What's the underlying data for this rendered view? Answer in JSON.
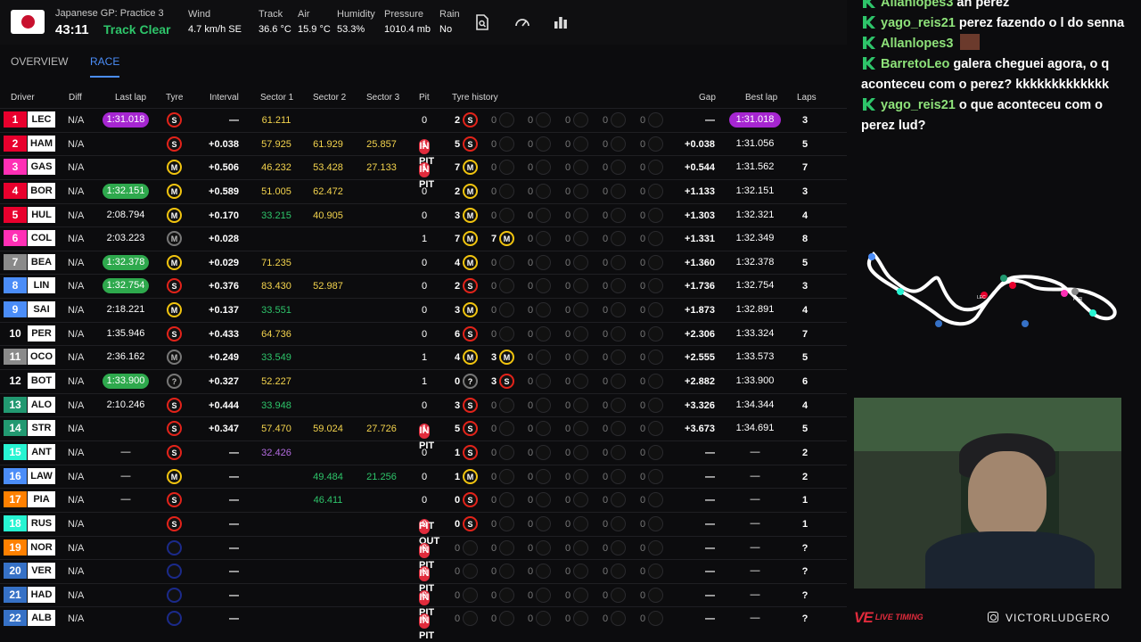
{
  "session": {
    "title": "Japanese GP: Practice 3",
    "clock": "43:11",
    "track_status": "Track Clear",
    "flag_icon": "japan-flag-icon"
  },
  "weather": [
    {
      "label": "Wind",
      "value": "4.7 km/h SE"
    },
    {
      "label": "Track",
      "value": "36.6 °C"
    },
    {
      "label": "Air",
      "value": "15.9 °C"
    },
    {
      "label": "Humidity",
      "value": "53.3%"
    },
    {
      "label": "Pressure",
      "value": "1010.4 mb"
    },
    {
      "label": "Rain",
      "value": "No"
    }
  ],
  "toolbar_icons": [
    "search-doc-icon",
    "speedometer-icon",
    "bar-chart-icon"
  ],
  "tabs": [
    {
      "label": "OVERVIEW",
      "active": false
    },
    {
      "label": "RACE",
      "active": true
    }
  ],
  "columns": {
    "driver": "Driver",
    "diff": "Diff",
    "last_lap": "Last lap",
    "tyre": "Tyre",
    "interval": "Interval",
    "s1": "Sector 1",
    "s2": "Sector 2",
    "s3": "Sector 3",
    "pit": "Pit",
    "tyre_history": "Tyre history",
    "gap": "Gap",
    "best_lap": "Best lap",
    "laps": "Laps"
  },
  "colors": {
    "personal_best": "#2ea94d",
    "overall_best": "#a626d1",
    "in_pit": "#e12b3c",
    "soft": "#e2231a",
    "medium": "#f1c40f",
    "sector_yellow": "#f4d44d",
    "sector_green": "#2ec56a",
    "sector_purple": "#b36be0",
    "accent": "#4b8df8"
  },
  "drivers": [
    {
      "pos": "1",
      "code": "LEC",
      "color": "#e8002d",
      "diff": "N/A",
      "last": "1:31.018",
      "last_style": "ob",
      "tyre": "S",
      "interval": "—",
      "s1": "61.211",
      "s1c": "y",
      "s2": "",
      "s2c": "",
      "s3": "",
      "s3c": "",
      "pit": "0",
      "hist": [
        [
          "2",
          "S"
        ],
        [
          "0",
          ""
        ],
        [
          "0",
          ""
        ],
        [
          "0",
          ""
        ],
        [
          "0",
          ""
        ],
        [
          "0",
          ""
        ]
      ],
      "gap": "—",
      "best": "1:31.018",
      "best_style": "ob",
      "laps": "3"
    },
    {
      "pos": "2",
      "code": "HAM",
      "color": "#e8002d",
      "diff": "N/A",
      "last": "IN PIT",
      "last_style": "pit",
      "tyre": "S",
      "interval": "+0.038",
      "s1": "57.925",
      "s1c": "y",
      "s2": "61.929",
      "s2c": "y",
      "s3": "25.857",
      "s3c": "y",
      "pit": "1",
      "hist": [
        [
          "5",
          "S"
        ],
        [
          "0",
          ""
        ],
        [
          "0",
          ""
        ],
        [
          "0",
          ""
        ],
        [
          "0",
          ""
        ],
        [
          "0",
          ""
        ]
      ],
      "gap": "+0.038",
      "best": "1:31.056",
      "best_style": "",
      "laps": "5"
    },
    {
      "pos": "3",
      "code": "GAS",
      "color": "#ff2fb5",
      "diff": "N/A",
      "last": "IN PIT",
      "last_style": "pit",
      "tyre": "M",
      "interval": "+0.506",
      "s1": "46.232",
      "s1c": "y",
      "s2": "53.428",
      "s2c": "y",
      "s3": "27.133",
      "s3c": "y",
      "pit": "1",
      "hist": [
        [
          "7",
          "M"
        ],
        [
          "0",
          ""
        ],
        [
          "0",
          ""
        ],
        [
          "0",
          ""
        ],
        [
          "0",
          ""
        ],
        [
          "0",
          ""
        ]
      ],
      "gap": "+0.544",
      "best": "1:31.562",
      "best_style": "",
      "laps": "7"
    },
    {
      "pos": "4",
      "code": "BOR",
      "color": "#e8002d",
      "diff": "N/A",
      "last": "1:32.151",
      "last_style": "pb",
      "tyre": "M",
      "interval": "+0.589",
      "s1": "51.005",
      "s1c": "y",
      "s2": "62.472",
      "s2c": "y",
      "s3": "",
      "s3c": "",
      "pit": "0",
      "hist": [
        [
          "2",
          "M"
        ],
        [
          "0",
          ""
        ],
        [
          "0",
          ""
        ],
        [
          "0",
          ""
        ],
        [
          "0",
          ""
        ],
        [
          "0",
          ""
        ]
      ],
      "gap": "+1.133",
      "best": "1:32.151",
      "best_style": "",
      "laps": "3"
    },
    {
      "pos": "5",
      "code": "HUL",
      "color": "#e8002d",
      "diff": "N/A",
      "last": "2:08.794",
      "last_style": "plain",
      "tyre": "M",
      "interval": "+0.170",
      "s1": "33.215",
      "s1c": "g",
      "s2": "40.905",
      "s2c": "y",
      "s3": "",
      "s3c": "",
      "pit": "0",
      "hist": [
        [
          "3",
          "M"
        ],
        [
          "0",
          ""
        ],
        [
          "0",
          ""
        ],
        [
          "0",
          ""
        ],
        [
          "0",
          ""
        ],
        [
          "0",
          ""
        ]
      ],
      "gap": "+1.303",
      "best": "1:32.321",
      "best_style": "",
      "laps": "4"
    },
    {
      "pos": "6",
      "code": "COL",
      "color": "#ff2fb5",
      "diff": "N/A",
      "last": "2:03.223",
      "last_style": "plain",
      "tyre": "U",
      "interval": "+0.028",
      "s1": "",
      "s1c": "",
      "s2": "",
      "s2c": "",
      "s3": "",
      "s3c": "",
      "pit": "1",
      "hist": [
        [
          "7",
          "M"
        ],
        [
          "7",
          "M"
        ],
        [
          "0",
          ""
        ],
        [
          "0",
          ""
        ],
        [
          "0",
          ""
        ],
        [
          "0",
          ""
        ]
      ],
      "gap": "+1.331",
      "best": "1:32.349",
      "best_style": "",
      "laps": "8"
    },
    {
      "pos": "7",
      "code": "BEA",
      "color": "#8a8a8a",
      "diff": "N/A",
      "last": "1:32.378",
      "last_style": "pb",
      "tyre": "M",
      "interval": "+0.029",
      "s1": "71.235",
      "s1c": "y",
      "s2": "",
      "s2c": "",
      "s3": "",
      "s3c": "",
      "pit": "0",
      "hist": [
        [
          "4",
          "M"
        ],
        [
          "0",
          ""
        ],
        [
          "0",
          ""
        ],
        [
          "0",
          ""
        ],
        [
          "0",
          ""
        ],
        [
          "0",
          ""
        ]
      ],
      "gap": "+1.360",
      "best": "1:32.378",
      "best_style": "",
      "laps": "5"
    },
    {
      "pos": "8",
      "code": "LIN",
      "color": "#4b8df8",
      "diff": "N/A",
      "last": "1:32.754",
      "last_style": "pb",
      "tyre": "S",
      "interval": "+0.376",
      "s1": "83.430",
      "s1c": "y",
      "s2": "52.987",
      "s2c": "y",
      "s3": "",
      "s3c": "",
      "pit": "0",
      "hist": [
        [
          "2",
          "S"
        ],
        [
          "0",
          ""
        ],
        [
          "0",
          ""
        ],
        [
          "0",
          ""
        ],
        [
          "0",
          ""
        ],
        [
          "0",
          ""
        ]
      ],
      "gap": "+1.736",
      "best": "1:32.754",
      "best_style": "",
      "laps": "3"
    },
    {
      "pos": "9",
      "code": "SAI",
      "color": "#4b8df8",
      "diff": "N/A",
      "last": "2:18.221",
      "last_style": "plain",
      "tyre": "M",
      "interval": "+0.137",
      "s1": "33.551",
      "s1c": "g",
      "s2": "",
      "s2c": "",
      "s3": "",
      "s3c": "",
      "pit": "0",
      "hist": [
        [
          "3",
          "M"
        ],
        [
          "0",
          ""
        ],
        [
          "0",
          ""
        ],
        [
          "0",
          ""
        ],
        [
          "0",
          ""
        ],
        [
          "0",
          ""
        ]
      ],
      "gap": "+1.873",
      "best": "1:32.891",
      "best_style": "",
      "laps": "4"
    },
    {
      "pos": "10",
      "code": "PER",
      "color": "#0c0c0e",
      "diff": "N/A",
      "last": "1:35.946",
      "last_style": "plain",
      "tyre": "S",
      "interval": "+0.433",
      "s1": "64.736",
      "s1c": "y",
      "s2": "",
      "s2c": "",
      "s3": "",
      "s3c": "",
      "pit": "0",
      "hist": [
        [
          "6",
          "S"
        ],
        [
          "0",
          ""
        ],
        [
          "0",
          ""
        ],
        [
          "0",
          ""
        ],
        [
          "0",
          ""
        ],
        [
          "0",
          ""
        ]
      ],
      "gap": "+2.306",
      "best": "1:33.324",
      "best_style": "",
      "laps": "7"
    },
    {
      "pos": "11",
      "code": "OCO",
      "color": "#8a8a8a",
      "diff": "N/A",
      "last": "2:36.162",
      "last_style": "plain",
      "tyre": "U",
      "interval": "+0.249",
      "s1": "33.549",
      "s1c": "g",
      "s2": "",
      "s2c": "",
      "s3": "",
      "s3c": "",
      "pit": "1",
      "hist": [
        [
          "4",
          "M"
        ],
        [
          "3",
          "M"
        ],
        [
          "0",
          ""
        ],
        [
          "0",
          ""
        ],
        [
          "0",
          ""
        ],
        [
          "0",
          ""
        ]
      ],
      "gap": "+2.555",
      "best": "1:33.573",
      "best_style": "",
      "laps": "5"
    },
    {
      "pos": "12",
      "code": "BOT",
      "color": "#0c0c0e",
      "diff": "N/A",
      "last": "1:33.900",
      "last_style": "pb",
      "tyre": "Q",
      "interval": "+0.327",
      "s1": "52.227",
      "s1c": "y",
      "s2": "",
      "s2c": "",
      "s3": "",
      "s3c": "",
      "pit": "1",
      "hist": [
        [
          "0",
          "Q"
        ],
        [
          "3",
          "S"
        ],
        [
          "0",
          ""
        ],
        [
          "0",
          ""
        ],
        [
          "0",
          ""
        ],
        [
          "0",
          ""
        ]
      ],
      "gap": "+2.882",
      "best": "1:33.900",
      "best_style": "",
      "laps": "6"
    },
    {
      "pos": "13",
      "code": "ALO",
      "color": "#229971",
      "diff": "N/A",
      "last": "2:10.246",
      "last_style": "plain",
      "tyre": "S",
      "interval": "+0.444",
      "s1": "33.948",
      "s1c": "g",
      "s2": "",
      "s2c": "",
      "s3": "",
      "s3c": "",
      "pit": "0",
      "hist": [
        [
          "3",
          "S"
        ],
        [
          "0",
          ""
        ],
        [
          "0",
          ""
        ],
        [
          "0",
          ""
        ],
        [
          "0",
          ""
        ],
        [
          "0",
          ""
        ]
      ],
      "gap": "+3.326",
      "best": "1:34.344",
      "best_style": "",
      "laps": "4"
    },
    {
      "pos": "14",
      "code": "STR",
      "color": "#229971",
      "diff": "N/A",
      "last": "IN PIT",
      "last_style": "pit",
      "tyre": "S",
      "interval": "+0.347",
      "s1": "57.470",
      "s1c": "y",
      "s2": "59.024",
      "s2c": "y",
      "s3": "27.726",
      "s3c": "y",
      "pit": "1",
      "hist": [
        [
          "5",
          "S"
        ],
        [
          "0",
          ""
        ],
        [
          "0",
          ""
        ],
        [
          "0",
          ""
        ],
        [
          "0",
          ""
        ],
        [
          "0",
          ""
        ]
      ],
      "gap": "+3.673",
      "best": "1:34.691",
      "best_style": "",
      "laps": "5"
    },
    {
      "pos": "15",
      "code": "ANT",
      "color": "#27f4d2",
      "diff": "N/A",
      "last": "—",
      "last_style": "plain",
      "tyre": "S",
      "interval": "—",
      "s1": "32.426",
      "s1c": "p",
      "s2": "",
      "s2c": "",
      "s3": "",
      "s3c": "",
      "pit": "0",
      "hist": [
        [
          "1",
          "S"
        ],
        [
          "0",
          ""
        ],
        [
          "0",
          ""
        ],
        [
          "0",
          ""
        ],
        [
          "0",
          ""
        ],
        [
          "0",
          ""
        ]
      ],
      "gap": "—",
      "best": "—",
      "best_style": "",
      "laps": "2"
    },
    {
      "pos": "16",
      "code": "LAW",
      "color": "#4b8df8",
      "diff": "N/A",
      "last": "—",
      "last_style": "plain",
      "tyre": "M",
      "interval": "—",
      "s1": "",
      "s1c": "",
      "s2": "49.484",
      "s2c": "g",
      "s3": "21.256",
      "s3c": "g",
      "pit": "0",
      "hist": [
        [
          "1",
          "M"
        ],
        [
          "0",
          ""
        ],
        [
          "0",
          ""
        ],
        [
          "0",
          ""
        ],
        [
          "0",
          ""
        ],
        [
          "0",
          ""
        ]
      ],
      "gap": "—",
      "best": "—",
      "best_style": "",
      "laps": "2"
    },
    {
      "pos": "17",
      "code": "PIA",
      "color": "#ff8000",
      "diff": "N/A",
      "last": "—",
      "last_style": "plain",
      "tyre": "S",
      "interval": "—",
      "s1": "",
      "s1c": "",
      "s2": "46.411",
      "s2c": "g",
      "s3": "",
      "s3c": "",
      "pit": "0",
      "hist": [
        [
          "0",
          "S"
        ],
        [
          "0",
          ""
        ],
        [
          "0",
          ""
        ],
        [
          "0",
          ""
        ],
        [
          "0",
          ""
        ],
        [
          "0",
          ""
        ]
      ],
      "gap": "—",
      "best": "—",
      "best_style": "",
      "laps": "1"
    },
    {
      "pos": "18",
      "code": "RUS",
      "color": "#27f4d2",
      "diff": "N/A",
      "last": "PIT OUT",
      "last_style": "pit",
      "tyre": "S",
      "interval": "—",
      "s1": "",
      "s1c": "",
      "s2": "",
      "s2c": "",
      "s3": "",
      "s3c": "",
      "pit": "0",
      "hist": [
        [
          "0",
          "S"
        ],
        [
          "0",
          ""
        ],
        [
          "0",
          ""
        ],
        [
          "0",
          ""
        ],
        [
          "0",
          ""
        ],
        [
          "0",
          ""
        ]
      ],
      "gap": "—",
      "best": "—",
      "best_style": "",
      "laps": "1"
    },
    {
      "pos": "19",
      "code": "NOR",
      "color": "#ff8000",
      "diff": "N/A",
      "last": "IN PIT",
      "last_style": "pit",
      "tyre": "E",
      "interval": "—",
      "s1": "",
      "s1c": "",
      "s2": "",
      "s2c": "",
      "s3": "",
      "s3c": "",
      "pit": "0",
      "hist": [
        [
          "0",
          ""
        ],
        [
          "0",
          ""
        ],
        [
          "0",
          ""
        ],
        [
          "0",
          ""
        ],
        [
          "0",
          ""
        ],
        [
          "0",
          ""
        ]
      ],
      "gap": "—",
      "best": "—",
      "best_style": "",
      "laps": "?"
    },
    {
      "pos": "20",
      "code": "VER",
      "color": "#3671c6",
      "diff": "N/A",
      "last": "IN PIT",
      "last_style": "pit",
      "tyre": "E",
      "interval": "—",
      "s1": "",
      "s1c": "",
      "s2": "",
      "s2c": "",
      "s3": "",
      "s3c": "",
      "pit": "0",
      "hist": [
        [
          "0",
          ""
        ],
        [
          "0",
          ""
        ],
        [
          "0",
          ""
        ],
        [
          "0",
          ""
        ],
        [
          "0",
          ""
        ],
        [
          "0",
          ""
        ]
      ],
      "gap": "—",
      "best": "—",
      "best_style": "",
      "laps": "?"
    },
    {
      "pos": "21",
      "code": "HAD",
      "color": "#3671c6",
      "diff": "N/A",
      "last": "IN PIT",
      "last_style": "pit",
      "tyre": "E",
      "interval": "—",
      "s1": "",
      "s1c": "",
      "s2": "",
      "s2c": "",
      "s3": "",
      "s3c": "",
      "pit": "0",
      "hist": [
        [
          "0",
          ""
        ],
        [
          "0",
          ""
        ],
        [
          "0",
          ""
        ],
        [
          "0",
          ""
        ],
        [
          "0",
          ""
        ],
        [
          "0",
          ""
        ]
      ],
      "gap": "—",
      "best": "—",
      "best_style": "",
      "laps": "?"
    },
    {
      "pos": "22",
      "code": "ALB",
      "color": "#3671c6",
      "diff": "N/A",
      "last": "IN PIT",
      "last_style": "pit",
      "tyre": "E",
      "interval": "—",
      "s1": "",
      "s1c": "",
      "s2": "",
      "s2c": "",
      "s3": "",
      "s3c": "",
      "pit": "0",
      "hist": [
        [
          "0",
          ""
        ],
        [
          "0",
          ""
        ],
        [
          "0",
          ""
        ],
        [
          "0",
          ""
        ],
        [
          "0",
          ""
        ],
        [
          "0",
          ""
        ]
      ],
      "gap": "—",
      "best": "—",
      "best_style": "",
      "laps": "?"
    }
  ],
  "chat": [
    {
      "user": "Allanlopes3",
      "text": "ah perez"
    },
    {
      "user": "yago_reis21",
      "text": "perez fazendo o l do senna"
    },
    {
      "user": "Allanlopes3",
      "text": "",
      "emote": true
    },
    {
      "user": "BarretoLeo",
      "text": "galera cheguei agora, o q aconteceu com o perez? kkkkkkkkkkkkk"
    },
    {
      "user": "yago_reis21",
      "text": "o que aconteceu com o perez lud?"
    }
  ],
  "map": {
    "labels": [
      "LEC",
      "PER"
    ]
  },
  "footer": {
    "brand": "VE",
    "brand_sub": "LIVE TIMING",
    "social_handle": "VICTORLUDGERO"
  }
}
